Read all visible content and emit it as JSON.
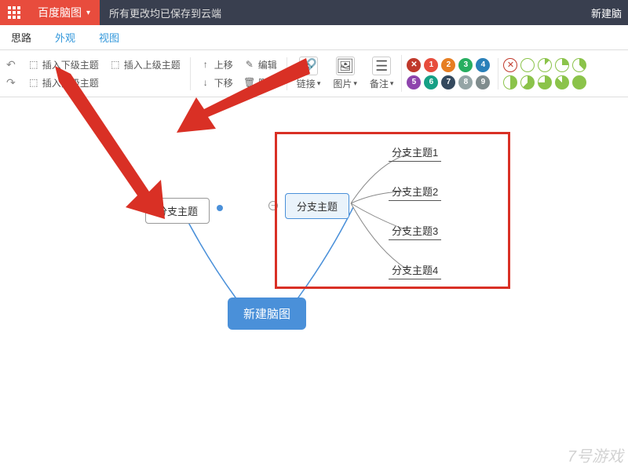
{
  "header": {
    "brand": "百度脑图",
    "save_status": "所有更改均已保存到云端",
    "new_btn": "新建脑"
  },
  "tabs": {
    "idea": "思路",
    "appearance": "外观",
    "view": "视图"
  },
  "toolbar": {
    "insert_child": "插入下级主题",
    "insert_parent": "插入上级主题",
    "insert_sibling": "插入同级主题",
    "move_up": "上移",
    "move_down": "下移",
    "edit": "编辑",
    "delete": "删除",
    "link": "链接",
    "image": "图片",
    "note": "备注"
  },
  "priority": {
    "remove_color": "#C0392B",
    "colors": [
      "#C0392B",
      "#E67E22",
      "#27AE60",
      "#2980B9",
      "#8E44AD",
      "#16A085",
      "#2C3E50",
      "#E74C3C",
      "#D35400"
    ],
    "labels_row1": [
      "✕",
      "1",
      "2",
      "3",
      "4"
    ],
    "labels_row2": [
      "5",
      "6",
      "7",
      "8",
      "9"
    ]
  },
  "progress": {
    "fills": [
      0,
      12,
      25,
      37,
      50,
      62,
      75,
      87,
      100
    ],
    "remove": true
  },
  "mindmap": {
    "root": "新建脑图",
    "left_branch": "分支主题",
    "right_branch": "分支主题",
    "children": [
      "分支主题1",
      "分支主题2",
      "分支主题3",
      "分支主题4"
    ]
  },
  "watermark": "7号游戏"
}
